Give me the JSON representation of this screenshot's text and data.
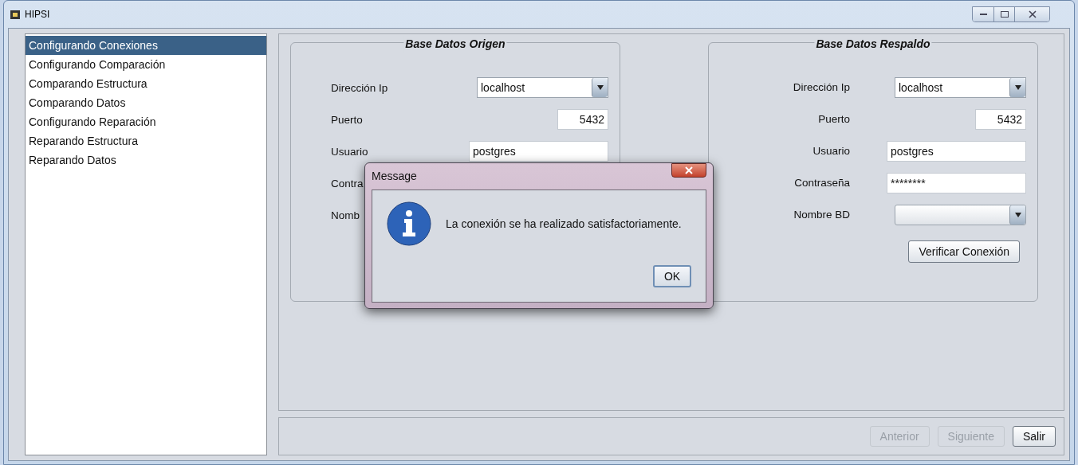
{
  "window": {
    "title": "HIPSI"
  },
  "sidebar": {
    "items": [
      {
        "label": "Configurando Conexiones",
        "selected": true
      },
      {
        "label": "Configurando Comparación",
        "selected": false
      },
      {
        "label": "Comparando Estructura",
        "selected": false
      },
      {
        "label": "Comparando Datos",
        "selected": false
      },
      {
        "label": "Configurando Reparación",
        "selected": false
      },
      {
        "label": "Reparando Estructura",
        "selected": false
      },
      {
        "label": "Reparando Datos",
        "selected": false
      }
    ]
  },
  "panels": [
    {
      "title": "Base Datos Origen",
      "rows": [
        {
          "label": "Dirección Ip",
          "field": {
            "kind": "combo",
            "value": "localhost"
          }
        },
        {
          "label": "Puerto",
          "field": {
            "kind": "short",
            "value": "5432"
          }
        },
        {
          "label": "Usuario",
          "field": {
            "kind": "text",
            "value": "postgres"
          }
        },
        {
          "label": "Contra"
        },
        {
          "label": "Nomb"
        }
      ]
    },
    {
      "title": "Base Datos Respaldo",
      "rows": [
        {
          "label": "Dirección Ip",
          "field": {
            "kind": "combo",
            "value": "localhost"
          }
        },
        {
          "label": "Puerto",
          "field": {
            "kind": "short",
            "value": "5432"
          }
        },
        {
          "label": "Usuario",
          "field": {
            "kind": "text",
            "value": "postgres"
          }
        },
        {
          "label": "Contraseña",
          "field": {
            "kind": "text",
            "value": "********"
          }
        },
        {
          "label": "Nombre BD",
          "field": {
            "kind": "combo"
          }
        }
      ],
      "button": "Verificar Conexión"
    }
  ],
  "footer": {
    "buttons": [
      {
        "label": "Anterior",
        "disabled": true
      },
      {
        "label": "Siguiente",
        "disabled": true
      },
      {
        "label": "Salir",
        "disabled": false
      }
    ]
  },
  "dialog": {
    "title": "Message",
    "message": "La conexión se ha realizado satisfactoriamente.",
    "button": "OK"
  }
}
